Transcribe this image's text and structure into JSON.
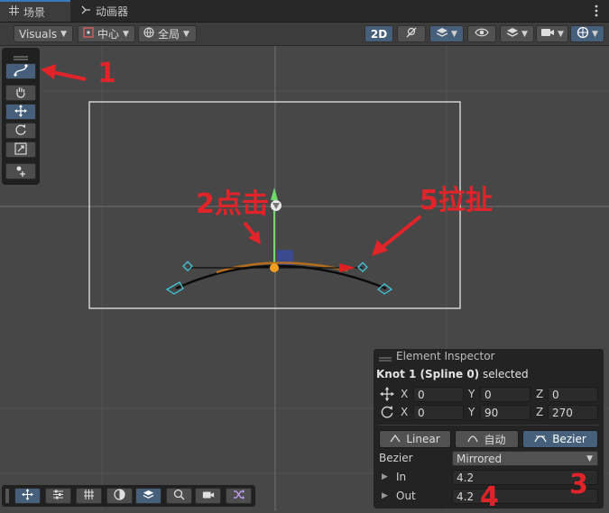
{
  "tabs": [
    {
      "label": "场景",
      "icon": "grid-icon",
      "active": true
    },
    {
      "label": "动画器",
      "icon": "animator-icon",
      "active": false
    }
  ],
  "toolbar": {
    "visuals_label": "Visuals",
    "pivot_label": "中心",
    "space_label": "全局",
    "mode_2d_label": "2D"
  },
  "annotations": {
    "a1": "1",
    "a2": "2点击",
    "a3": "3",
    "a4": "4",
    "a5": "5拉扯"
  },
  "inspector": {
    "title": "Element Inspector",
    "selection_bold": "Knot 1 (Spline 0)",
    "selection_suffix": " selected",
    "position": {
      "x_label": "X",
      "x": "0",
      "y_label": "Y",
      "y": "0",
      "z_label": "Z",
      "z": "0"
    },
    "rotation": {
      "x_label": "X",
      "x": "0",
      "y_label": "Y",
      "y": "90",
      "z_label": "Z",
      "z": "270"
    },
    "modes": [
      "Linear",
      "自动",
      "Bezier"
    ],
    "bezier_label": "Bezier",
    "bezier_value": "Mirrored",
    "in_label": "In",
    "in_value": "4.2",
    "out_label": "Out",
    "out_value": "4.2"
  },
  "colors": {
    "accent": "#46607c",
    "annotation": "#e0242a",
    "spline_handle": "#3fc5d8",
    "tangent": "#e07a10"
  }
}
